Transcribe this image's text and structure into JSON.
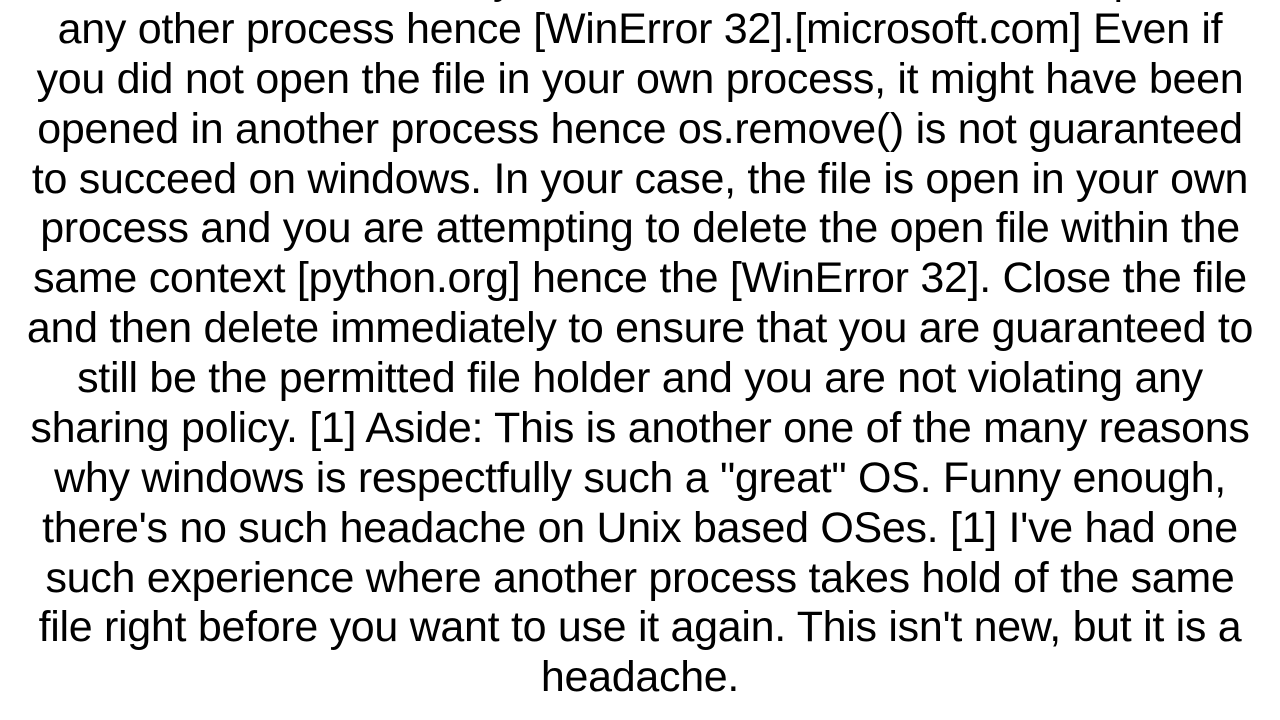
{
  "document": {
    "body_text": "Once the file is loaded, you cannot load while the file is open in any other process hence [WinError 32].[microsoft.com] Even if you did not open the file in your own process, it might have been opened in another process hence os.remove() is not guaranteed to succeed on windows. In your case, the file is open in your own process and you are attempting to delete the open file within the same context [python.org] hence the [WinError 32]. Close the file and then delete immediately to ensure that you are guaranteed to still be the permitted file holder and you are not violating any sharing policy. [1] Aside: This is another one of the many reasons why windows is respectfully such a \"great\" OS. Funny enough, there's no such headache on Unix based OSes.  [1] I've had one such experience where another process takes hold of the same file right before you want to use it again. This isn't new, but it is a headache."
  }
}
